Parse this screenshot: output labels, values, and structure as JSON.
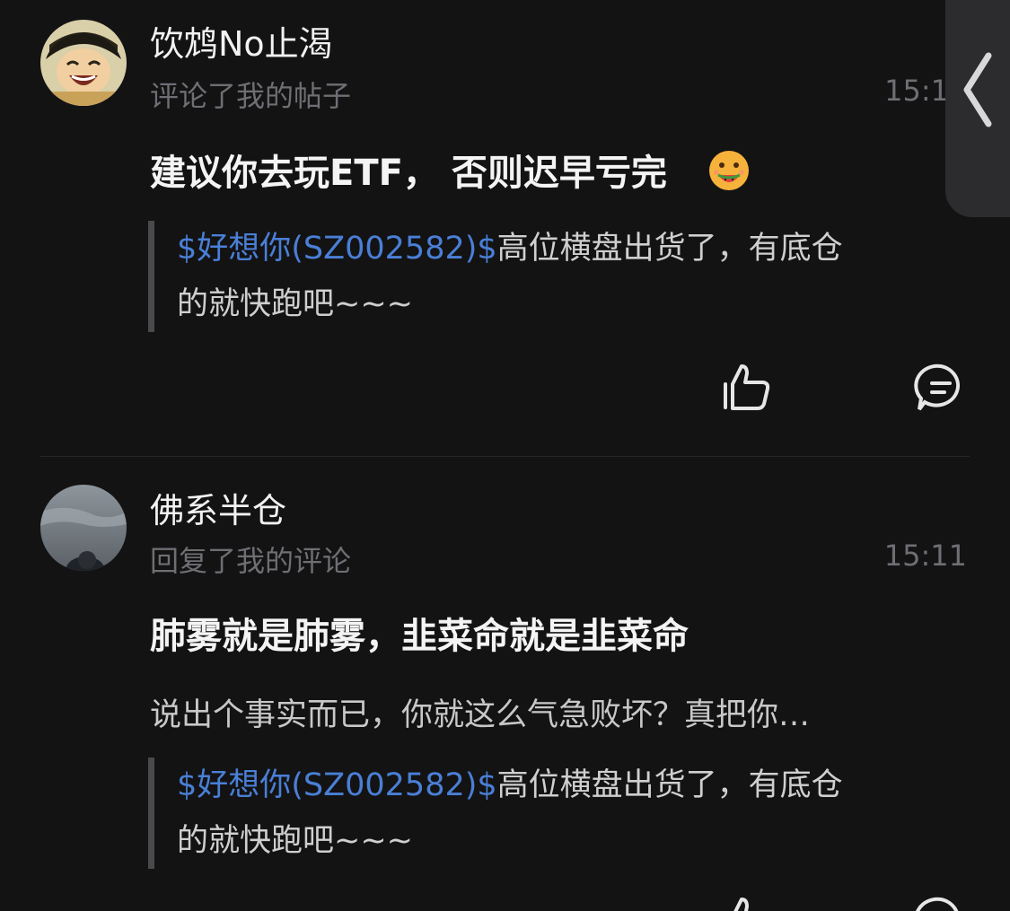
{
  "comments": [
    {
      "username": "饮鸩No止渴",
      "action": "评论了我的帖子",
      "time": "15:1",
      "title": "建议你去玩ETF， 否则迟早亏完",
      "title_emoji": "watermelon-face-emoji",
      "quote_stock": "$好想你(SZ002582)$",
      "quote_text": "高位横盘出货了，有底仓",
      "quote_text_2": "的就快跑吧~~~"
    },
    {
      "username": "佛系半仓",
      "action": "回复了我的评论",
      "time": "15:11",
      "title": "肺雾就是肺雾，韭菜命就是韭菜命",
      "reply": "说出个事实而已，你就这么气急败坏？真把你…",
      "quote_stock": "$好想你(SZ002582)$",
      "quote_text": "高位横盘出货了，有底仓",
      "quote_text_2": "的就快跑吧~~~"
    }
  ],
  "icons": {
    "like": "thumbs-up-icon",
    "comment": "comment-bubble-icon",
    "back": "chevron-left-icon"
  },
  "colors": {
    "background": "#131314",
    "stock_link": "#4a7fd6",
    "muted_text": "#6e6e73"
  }
}
